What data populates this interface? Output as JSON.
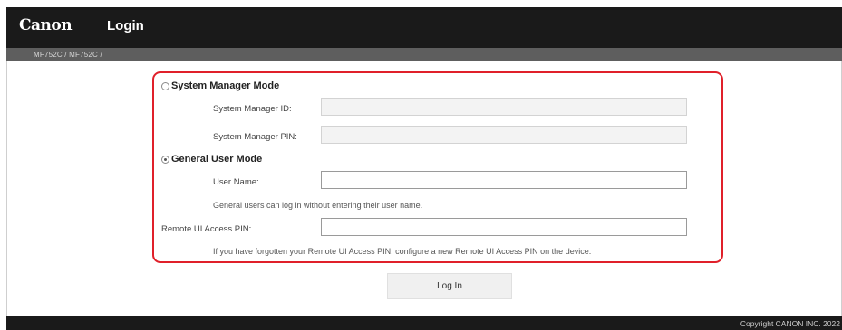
{
  "header": {
    "logo": "Canon",
    "title": "Login"
  },
  "breadcrumb": "MF752C / MF752C /",
  "system_manager": {
    "mode_label": "System Manager Mode",
    "selected": false,
    "id_label": "System Manager ID:",
    "id_value": "",
    "pin_label": "System Manager PIN:",
    "pin_value": ""
  },
  "general_user": {
    "mode_label": "General User Mode",
    "selected": true,
    "user_name_label": "User Name:",
    "user_name_value": "",
    "hint": "General users can log in without entering their user name."
  },
  "remote_ui": {
    "pin_label": "Remote UI Access PIN:",
    "pin_value": "",
    "hint": "If you have forgotten your Remote UI Access PIN, configure a new Remote UI Access PIN on the device."
  },
  "login_button_label": "Log In",
  "footer": {
    "copyright": "Copyright CANON INC. 2022"
  },
  "colors": {
    "header_bg": "#1a1a1a",
    "breadcrumb_bg": "#5e5e5e",
    "highlight_border": "#e0202a"
  }
}
